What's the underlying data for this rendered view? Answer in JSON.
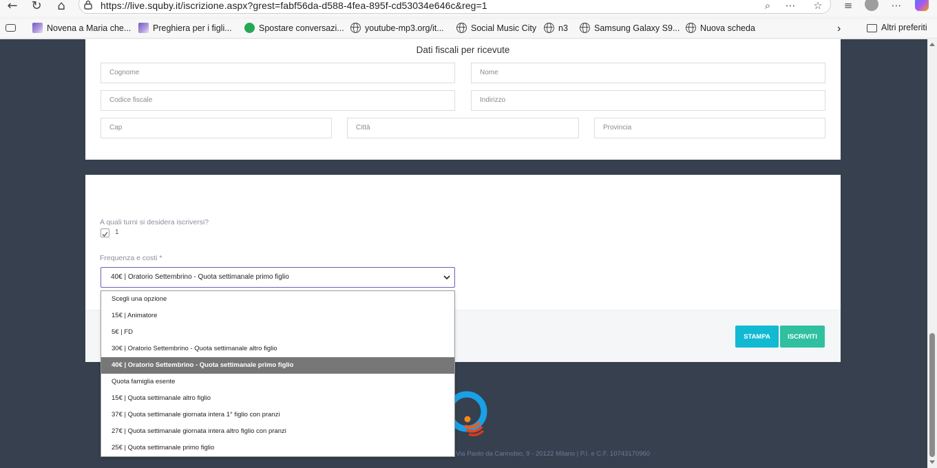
{
  "browser": {
    "url": "https://live.squby.it/iscrizione.aspx?grest=fabf56da-d588-4fea-895f-cd53034e646c&reg=1",
    "bookmarks": [
      {
        "label": "Novena a Maria che...",
        "icon": "book-icon"
      },
      {
        "label": "Preghiera per i figli...",
        "icon": "book-icon"
      },
      {
        "label": "Spostare conversazi...",
        "icon": "whatsapp-icon"
      },
      {
        "label": "youtube-mp3.org/it...",
        "icon": "globe-icon"
      },
      {
        "label": "Social Music City",
        "icon": "globe-icon"
      },
      {
        "label": "n3",
        "icon": "globe-icon"
      },
      {
        "label": "Samsung Galaxy S9...",
        "icon": "globe-icon"
      },
      {
        "label": "Nuova scheda",
        "icon": "globe-icon"
      }
    ],
    "other_favorites": "Altri preferiti"
  },
  "fiscal": {
    "title": "Dati fiscali per ricevute",
    "cognome": "Cognome",
    "nome": "Nome",
    "codice_fiscale": "Codice fiscale",
    "indirizzo": "Indirizzo",
    "cap": "Cap",
    "citta": "Città",
    "provincia": "Provincia"
  },
  "registration": {
    "turni_label": "A quali turni si desidera iscriversi?",
    "turno_value": "1",
    "frequenza_label": "Frequenza e costi *",
    "selected": "40€ | Oratorio Settembrino - Quota settimanale primo figlio",
    "options": [
      "Scegli una opzione",
      "15€ | Animatore",
      "5€ | FD",
      "30€ | Oratorio Settembrino - Quota settimanale altro figlio",
      "40€ | Oratorio Settembrino - Quota settimanale primo figlio",
      "Quota famiglia esente",
      "15€ | Quota settimanale altro figlio",
      "37€ | Quota settimanale giornata intera 1° figlio con pranzi",
      "27€ | Quota settimanale giornata intera altro figlio con pranzi",
      "25€ | Quota settimanale primo figlio"
    ],
    "selected_index": 4,
    "print_button": "STAMPA",
    "register_button": "ISCRIVITI"
  },
  "footer": {
    "text": "Via Paolo da Cannobio, 9 - 20122 Milano | P.I. e C.F. 10743170960"
  },
  "colors": {
    "page_bg": "#36404e",
    "print_btn": "#12b9d2",
    "register_btn": "#2fc0a0",
    "select_border": "#6b5fb5"
  }
}
